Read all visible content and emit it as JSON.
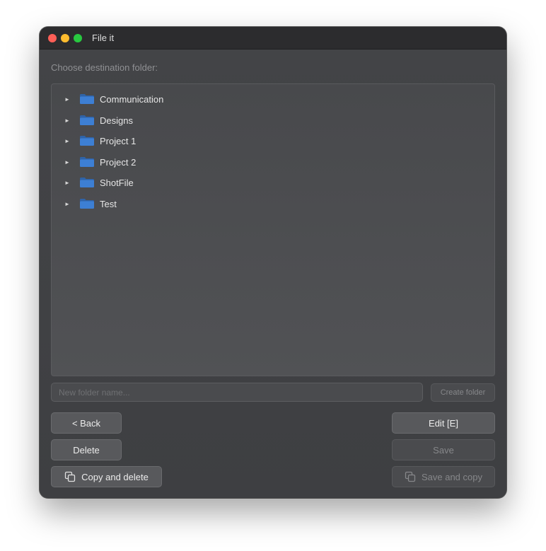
{
  "window": {
    "title": "File it"
  },
  "main": {
    "choose_label": "Choose destination folder:",
    "folders": [
      {
        "name": "Communication"
      },
      {
        "name": "Designs"
      },
      {
        "name": "Project 1"
      },
      {
        "name": "Project 2"
      },
      {
        "name": "ShotFile"
      },
      {
        "name": "Test"
      }
    ],
    "new_folder_placeholder": "New folder name...",
    "new_folder_value": ""
  },
  "buttons": {
    "create_folder": "Create folder",
    "back": "< Back",
    "edit": "Edit [E]",
    "delete": "Delete",
    "save": "Save",
    "copy_and_delete": "Copy and delete",
    "save_and_copy": "Save and copy"
  },
  "icons": {
    "folder": "folder-icon",
    "disclosure": "disclosure-triangle-icon",
    "copy": "copy-icon"
  },
  "colors": {
    "folder_blue": "#3d7fd4",
    "close": "#ff5f57",
    "minimize": "#febc2e",
    "maximize": "#28c840"
  }
}
